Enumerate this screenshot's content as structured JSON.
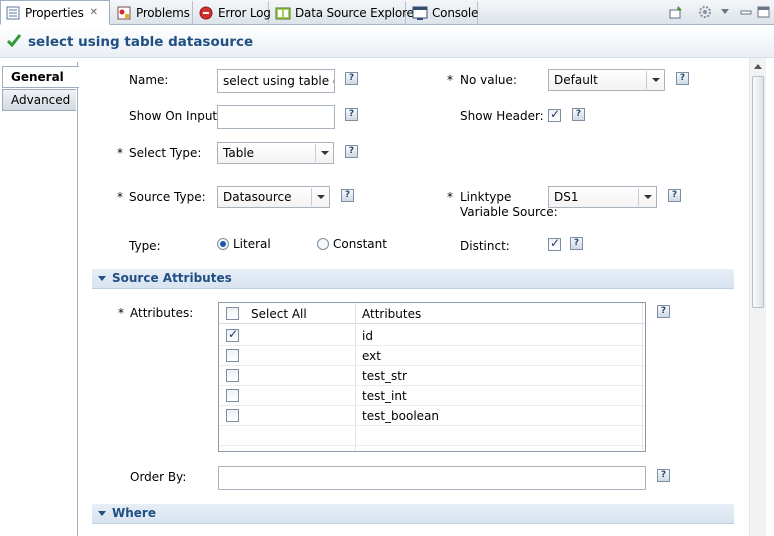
{
  "tabs": [
    {
      "label": "Properties",
      "icon": "properties-icon",
      "active": true,
      "closable": true
    },
    {
      "label": "Problems",
      "icon": "problems-icon"
    },
    {
      "label": "Error Log",
      "icon": "error-log-icon"
    },
    {
      "label": "Data Source Explorer",
      "icon": "data-source-explorer-icon"
    },
    {
      "label": "Console",
      "icon": "console-icon"
    }
  ],
  "toolbar": {
    "close_glyph": "✕"
  },
  "title": {
    "text": "select using table datasource",
    "icon": "check-icon"
  },
  "side_tabs": [
    {
      "label": "General",
      "active": true
    },
    {
      "label": "Advanced",
      "active": false
    }
  ],
  "form": {
    "required_mark": "*",
    "help_glyph": "?",
    "name": {
      "label": "Name:",
      "value": "select using table da"
    },
    "no_value": {
      "label": "No value:",
      "value": "Default"
    },
    "show_on_input": {
      "label": "Show On Input:",
      "value": ""
    },
    "show_header": {
      "label": "Show Header:",
      "checked": true
    },
    "select_type": {
      "label": "Select Type:",
      "value": "Table"
    },
    "source_type": {
      "label": "Source Type:",
      "value": "Datasource"
    },
    "linktype": {
      "label_line1": "Linktype",
      "label_line2": "Variable Source:",
      "value": "DS1"
    },
    "type": {
      "label": "Type:",
      "options": [
        "Literal",
        "Constant"
      ],
      "selected": "Literal"
    },
    "distinct": {
      "label": "Distinct:",
      "checked": true
    },
    "order_by": {
      "label": "Order By:",
      "value": ""
    }
  },
  "sections": {
    "source_attributes": "Source Attributes",
    "where": "Where"
  },
  "attributes": {
    "label": "Attributes:",
    "columns": [
      "Select All",
      "Attributes"
    ],
    "rows": [
      {
        "name": "id",
        "checked": true
      },
      {
        "name": "ext",
        "checked": false
      },
      {
        "name": "test_str",
        "checked": false
      },
      {
        "name": "test_int",
        "checked": false
      },
      {
        "name": "test_boolean",
        "checked": false
      }
    ]
  }
}
